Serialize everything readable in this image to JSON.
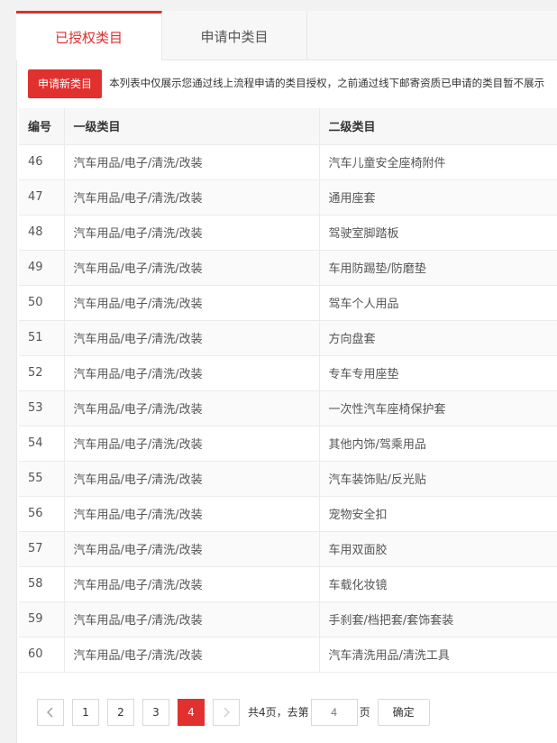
{
  "tabs": [
    {
      "label": "已授权类目",
      "active": true
    },
    {
      "label": "申请中类目",
      "active": false
    }
  ],
  "toolbar": {
    "apply_button": "申请新类目",
    "notice": "本列表中仅展示您通过线上流程申请的类目授权，之前通过线下邮寄资质已申请的类目暂不展示"
  },
  "table": {
    "headers": [
      "编号",
      "一级类目",
      "二级类目"
    ],
    "rows": [
      [
        "46",
        "汽车用品/电子/清洗/改装",
        "汽车儿童安全座椅附件"
      ],
      [
        "47",
        "汽车用品/电子/清洗/改装",
        "通用座套"
      ],
      [
        "48",
        "汽车用品/电子/清洗/改装",
        "驾驶室脚踏板"
      ],
      [
        "49",
        "汽车用品/电子/清洗/改装",
        "车用防踢垫/防磨垫"
      ],
      [
        "50",
        "汽车用品/电子/清洗/改装",
        "驾车个人用品"
      ],
      [
        "51",
        "汽车用品/电子/清洗/改装",
        "方向盘套"
      ],
      [
        "52",
        "汽车用品/电子/清洗/改装",
        "专车专用座垫"
      ],
      [
        "53",
        "汽车用品/电子/清洗/改装",
        "一次性汽车座椅保护套"
      ],
      [
        "54",
        "汽车用品/电子/清洗/改装",
        "其他内饰/驾乘用品"
      ],
      [
        "55",
        "汽车用品/电子/清洗/改装",
        "汽车装饰贴/反光贴"
      ],
      [
        "56",
        "汽车用品/电子/清洗/改装",
        "宠物安全扣"
      ],
      [
        "57",
        "汽车用品/电子/清洗/改装",
        "车用双面胶"
      ],
      [
        "58",
        "汽车用品/电子/清洗/改装",
        "车载化妆镜"
      ],
      [
        "59",
        "汽车用品/电子/清洗/改装",
        "手刹套/档把套/套饰套装"
      ],
      [
        "60",
        "汽车用品/电子/清洗/改装",
        "汽车清洗用品/清洗工具"
      ]
    ]
  },
  "pagination": {
    "prev_icon": "chevron-left-icon",
    "next_icon": "chevron-right-icon",
    "pages": [
      "1",
      "2",
      "3",
      "4"
    ],
    "current_page": "4",
    "total_text": "共4页，去第",
    "page_input_placeholder": "4",
    "page_suffix": "页",
    "confirm_label": "确定"
  },
  "colors": {
    "accent": "#e0312f"
  }
}
